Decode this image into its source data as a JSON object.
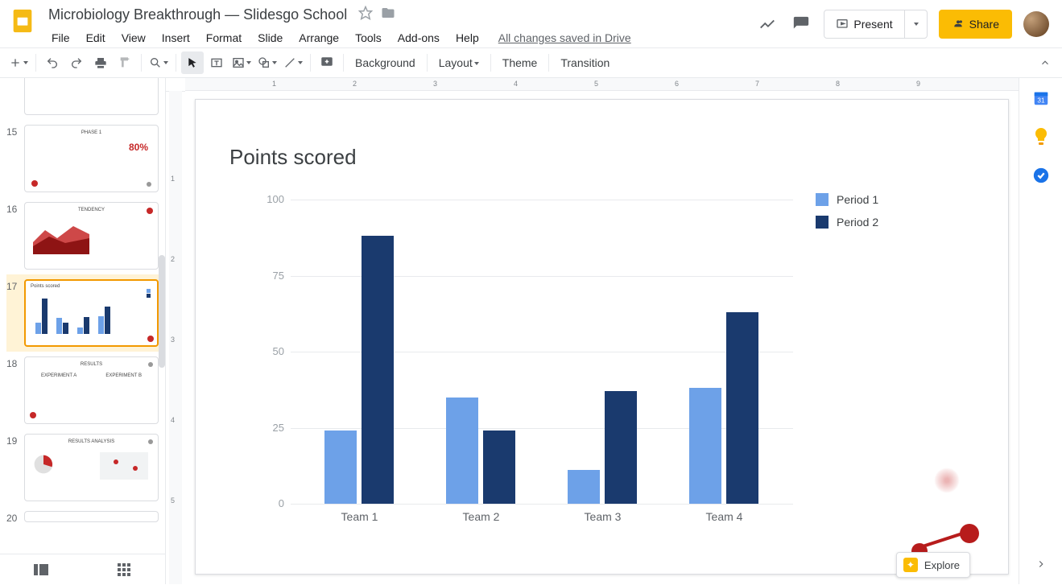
{
  "doc_title": "Microbiology Breakthrough — Slidesgo School",
  "save_status": "All changes saved in Drive",
  "menus": {
    "file": "File",
    "edit": "Edit",
    "view": "View",
    "insert": "Insert",
    "format": "Format",
    "slide": "Slide",
    "arrange": "Arrange",
    "tools": "Tools",
    "addons": "Add-ons",
    "help": "Help"
  },
  "titlebar": {
    "present": "Present",
    "share": "Share"
  },
  "toolbar": {
    "background": "Background",
    "layout": "Layout",
    "theme": "Theme",
    "transition": "Transition"
  },
  "filmstrip": {
    "visible_numbers": [
      "15",
      "16",
      "17",
      "18",
      "19",
      "20"
    ],
    "selected_index": 17,
    "thumbs": {
      "t15": {
        "title": "PHASE 1",
        "big_pct": "80%"
      },
      "t16": {
        "title": "TENDENCY"
      },
      "t17": {
        "title": "Points scored"
      },
      "t18": {
        "title": "RESULTS"
      },
      "t19": {
        "title": "RESULTS ANALYSIS"
      }
    }
  },
  "ruler_h": [
    "1",
    "2",
    "3",
    "4",
    "5",
    "6",
    "7",
    "8",
    "9"
  ],
  "ruler_v": [
    "1",
    "2",
    "3",
    "4",
    "5"
  ],
  "chart_data": {
    "type": "bar",
    "title": "Points scored",
    "categories": [
      "Team 1",
      "Team 2",
      "Team 3",
      "Team 4"
    ],
    "series": [
      {
        "name": "Period 1",
        "values": [
          24,
          35,
          11,
          38
        ],
        "color": "#6da1e8"
      },
      {
        "name": "Period 2",
        "values": [
          88,
          24,
          37,
          63
        ],
        "color": "#1a3a6e"
      }
    ],
    "y_ticks": [
      0,
      25,
      50,
      75,
      100
    ],
    "ylim": [
      0,
      100
    ],
    "xlabel": "",
    "ylabel": ""
  },
  "explore_label": "Explore"
}
